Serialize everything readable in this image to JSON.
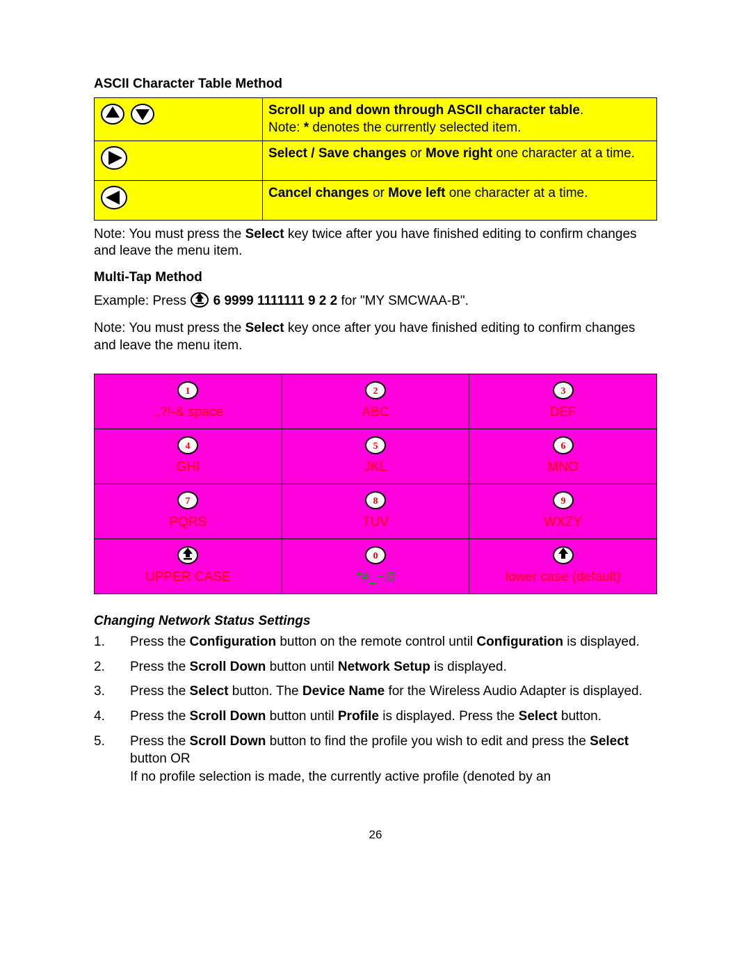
{
  "section1": {
    "title": "ASCII Character Table Method",
    "rows": [
      {
        "icons": [
          "up-arrow",
          "down-arrow"
        ],
        "text_pre_b": "",
        "bold1": "Scroll up and down through ASCII character table",
        "after_bold1": ".",
        "line2_pre": "Note: ",
        "line2_b": "*",
        "line2_post": " denotes the currently selected item."
      },
      {
        "icons": [
          "right-arrow"
        ],
        "bold1": "Select / Save changes",
        "mid": " or ",
        "bold2": "Move right",
        "after": " one character at a time."
      },
      {
        "icons": [
          "left-arrow"
        ],
        "bold1": "Cancel changes",
        "mid": " or ",
        "bold2": "Move left",
        "after": " one character at a time."
      }
    ],
    "note_pre": "Note: You must press the ",
    "note_b": "Select",
    "note_post": " key twice after you have finished editing to confirm changes and leave the menu item."
  },
  "section2": {
    "title": "Multi-Tap Method",
    "example_pre": "Example: Press ",
    "example_seq": " 6 9999 1111111 9 2 2",
    "example_post": " for \"MY SMCWAA-B\".",
    "note_pre": "Note: You must press the ",
    "note_b": "Select",
    "note_post": " key once after you have finished editing to confirm changes and leave the menu item."
  },
  "keypad": [
    [
      {
        "glyph": "1",
        "label": ".,?!-& space",
        "green": false,
        "icon": null
      },
      {
        "glyph": "2",
        "label": "ABC",
        "green": false,
        "icon": null
      },
      {
        "glyph": "3",
        "label": "DEF",
        "green": false,
        "icon": null
      }
    ],
    [
      {
        "glyph": "4",
        "label": "GHI",
        "green": false,
        "icon": null
      },
      {
        "glyph": "5",
        "label": "JKL",
        "green": false,
        "icon": null
      },
      {
        "glyph": "6",
        "label": "MNO",
        "green": false,
        "icon": null
      }
    ],
    [
      {
        "glyph": "7",
        "label": "PQRS",
        "green": false,
        "icon": null
      },
      {
        "glyph": "8",
        "label": "TUV",
        "green": false,
        "icon": null
      },
      {
        "glyph": "9",
        "label": "WXZY",
        "green": false,
        "icon": null
      }
    ],
    [
      {
        "glyph": null,
        "label": "UPPER CASE",
        "green": false,
        "icon": "upper-case-icon"
      },
      {
        "glyph": "0",
        "label": "*#_~:0",
        "green": true,
        "icon": null
      },
      {
        "glyph": null,
        "label": "lower case (default)",
        "green": false,
        "icon": "lower-case-icon"
      }
    ]
  ],
  "section3": {
    "title": "Changing Network Status Settings",
    "steps": [
      {
        "n": "1.",
        "html": "Press the <b>Configuration</b> button on the remote control until <b>Configuration</b> is displayed."
      },
      {
        "n": "2.",
        "html": "Press the <b>Scroll Down</b> button until <b>Network Setup</b> is displayed."
      },
      {
        "n": "3.",
        "html": "Press the <b>Select</b> button. The <b>Device Name</b> for the Wireless Audio Adapter is displayed."
      },
      {
        "n": "4.",
        "html": "Press the <b>Scroll Down</b> button until <b>Profile</b> is displayed. Press the <b>Select</b> button."
      },
      {
        "n": "5.",
        "html": "Press the <b>Scroll Down</b> button to find the profile you wish to edit and press the <b>Select</b> button OR<br>If no profile selection is made, the currently active profile (denoted by an"
      }
    ]
  },
  "page_number": "26"
}
